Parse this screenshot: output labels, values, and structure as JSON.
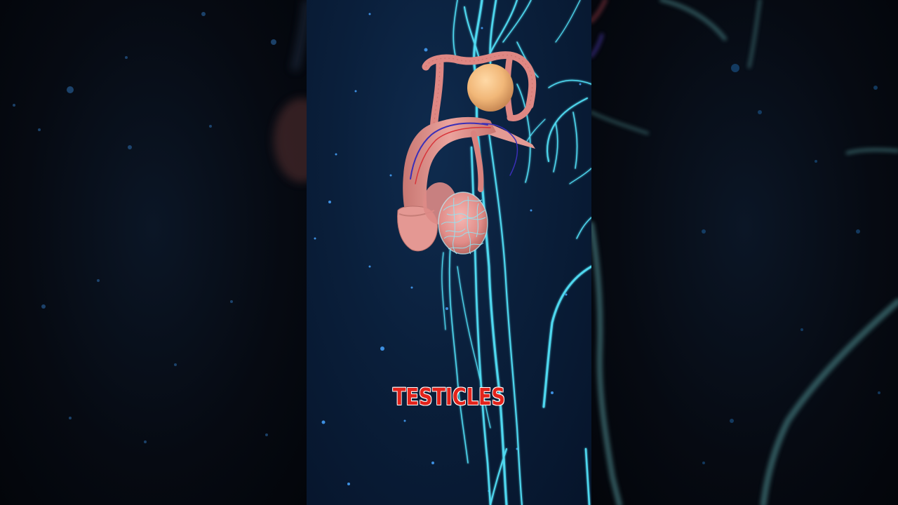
{
  "caption": {
    "text": "TESTICLES"
  },
  "colors": {
    "caption_red": "#e3231b",
    "background_navy": "#0a1f3b",
    "vessel_cyan": "#4fd8ef",
    "organ_pink": "#e48f8a"
  },
  "scene": {
    "subject": "male-reproductive-anatomy-3d-render",
    "background": "starry-dark-blue"
  }
}
